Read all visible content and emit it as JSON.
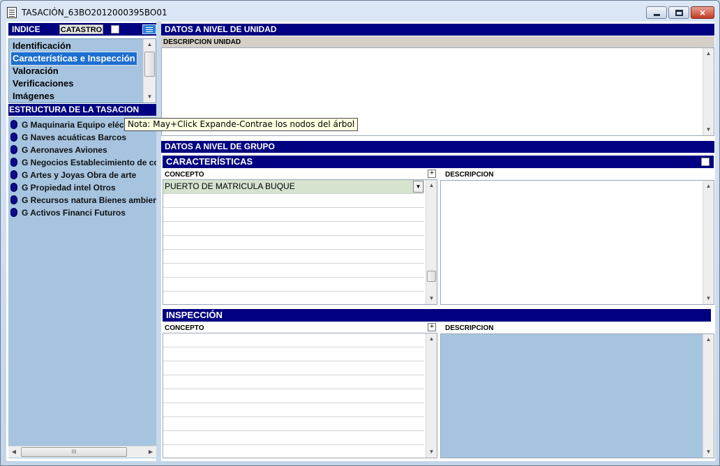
{
  "window": {
    "title": "TASACIÓN_63BO2012000395BO01",
    "close_label": "×"
  },
  "indice": {
    "header": "INDICE",
    "catastro_label": "CATASTRO",
    "items": [
      {
        "label": "Identificación",
        "selected": false
      },
      {
        "label": "Características e Inspección",
        "selected": true
      },
      {
        "label": "Valoración",
        "selected": false
      },
      {
        "label": "Verificaciones",
        "selected": false
      },
      {
        "label": "Imágenes",
        "selected": false
      }
    ]
  },
  "estructura": {
    "header": "ESTRUCTURA DE LA TASACION",
    "nodes": [
      "G Maquinaria Equipo eléct",
      "G Naves acuáticas Barcos",
      "G Aeronaves Aviones",
      "G Negocios Establecimiento de co",
      "G Artes y Joyas Obra de arte",
      "G Propiedad intel Otros",
      "G Recursos natura Bienes ambien",
      "G Activos Financi Futuros"
    ],
    "hscroll_thumb": "III"
  },
  "tooltip": "Nota: May+Click Expande-Contrae los nodos del árbol",
  "unidad": {
    "header": "DATOS A NIVEL DE UNIDAD",
    "desc_label": "DESCRIPCION UNIDAD"
  },
  "grupo": {
    "header": "DATOS A NIVEL DE GRUPO"
  },
  "caracteristicas": {
    "header": "CARACTERÍSTICAS",
    "concepto_label": "CONCEPTO",
    "descripcion_label": "DESCRIPCION",
    "plus_label": "+",
    "rows": [
      "PUERTO DE MATRICULA BUQUE",
      "",
      "",
      "",
      "",
      "",
      "",
      ""
    ]
  },
  "inspeccion": {
    "header": "INSPECCIÓN",
    "concepto_label": "CONCEPTO",
    "descripcion_label": "DESCRIPCION",
    "plus_label": "+",
    "rows": [
      "",
      "",
      "",
      "",
      "",
      "",
      "",
      ""
    ]
  },
  "colors": {
    "header_bg": "#000080",
    "panel_blue": "#a6c4e0",
    "selected_bg": "#1e6fd0",
    "row_highlight": "#d5e3cf"
  }
}
